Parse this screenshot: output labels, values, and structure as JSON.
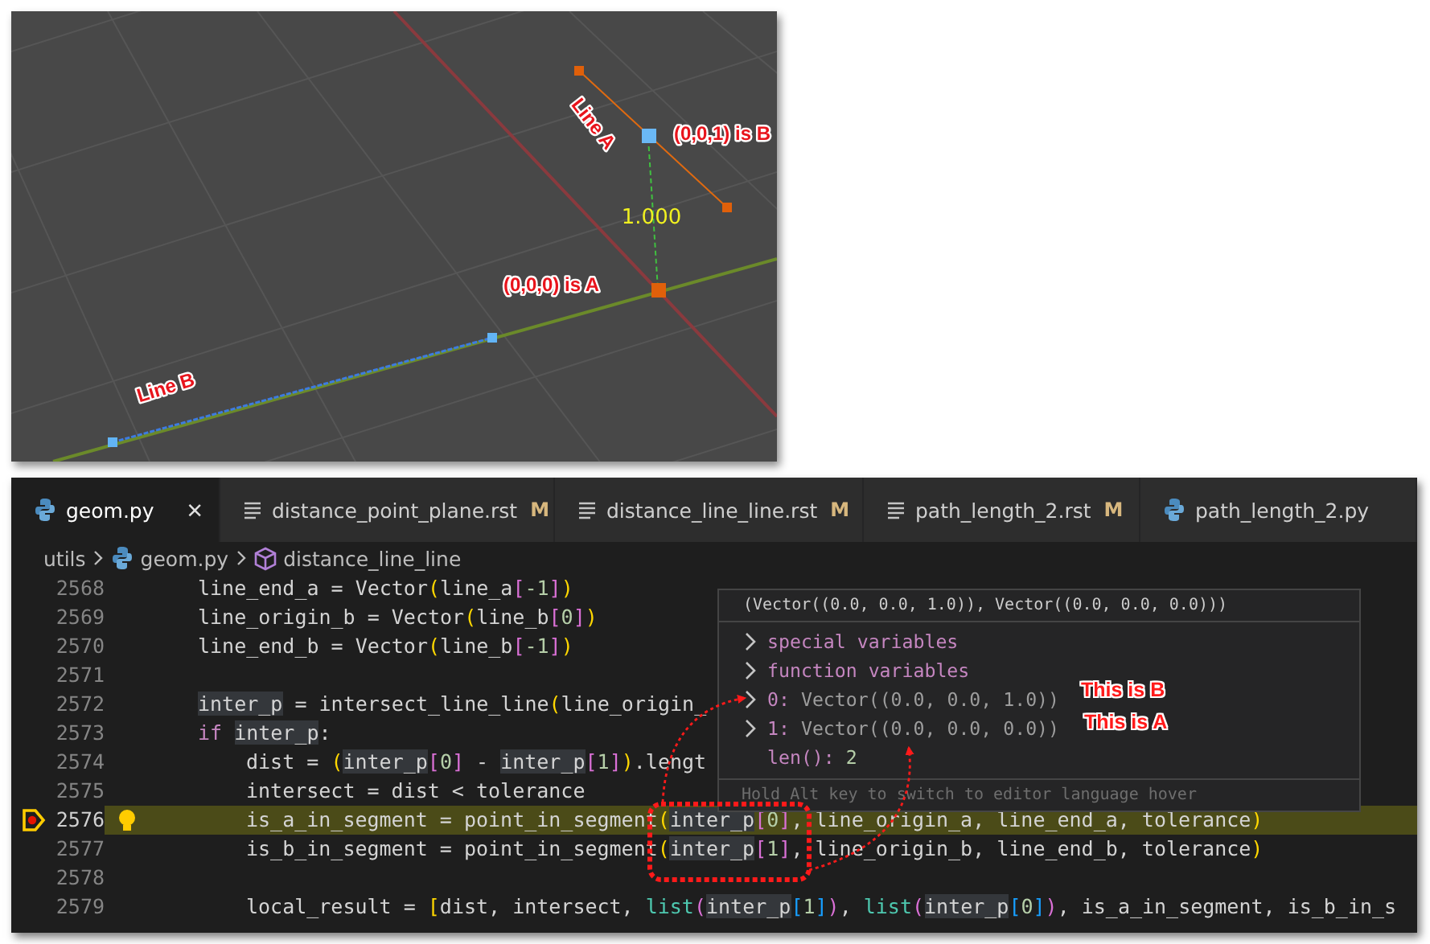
{
  "viewport": {
    "labels": [
      "Line A",
      "(0,0,1) is B",
      "(0,0,0) is A",
      "Line B"
    ],
    "dimension": "1.000"
  },
  "editor": {
    "tabs": [
      {
        "label": "geom.py",
        "kind": "python",
        "close": "×",
        "selected": true
      },
      {
        "label": "distance_point_plane.rst",
        "kind": "text",
        "badge": "M",
        "selected": false
      },
      {
        "label": "distance_line_line.rst",
        "kind": "text",
        "badge": "M",
        "selected": false
      },
      {
        "label": "path_length_2.rst",
        "kind": "text",
        "badge": "M",
        "selected": false
      },
      {
        "label": "path_length_2.py",
        "kind": "python",
        "selected": false
      }
    ],
    "breadcrumb": [
      {
        "label": "utils"
      },
      {
        "label": "geom.py",
        "kind": "python"
      },
      {
        "label": "distance_line_line",
        "kind": "symbol"
      }
    ],
    "lines": [
      {
        "number": "2568",
        "current": false,
        "segments": [
          {
            "text": "line_end_a = Vector",
            "kind": "plain"
          },
          {
            "text": "(",
            "kind": "bracket1"
          },
          {
            "text": "line_a",
            "kind": "plain"
          },
          {
            "text": "[",
            "kind": "bracket2"
          },
          {
            "text": "-1",
            "kind": "number"
          },
          {
            "text": "]",
            "kind": "bracket2"
          },
          {
            "text": ")",
            "kind": "bracket1"
          }
        ]
      },
      {
        "number": "2569",
        "current": false,
        "segments": [
          {
            "text": "line_origin_b = Vector",
            "kind": "plain"
          },
          {
            "text": "(",
            "kind": "bracket1"
          },
          {
            "text": "line_b",
            "kind": "plain"
          },
          {
            "text": "[",
            "kind": "bracket2"
          },
          {
            "text": "0",
            "kind": "number"
          },
          {
            "text": "]",
            "kind": "bracket2"
          },
          {
            "text": ")",
            "kind": "bracket1"
          }
        ]
      },
      {
        "number": "2570",
        "current": false,
        "segments": [
          {
            "text": "line_end_b = Vector",
            "kind": "plain"
          },
          {
            "text": "(",
            "kind": "bracket1"
          },
          {
            "text": "line_b",
            "kind": "plain"
          },
          {
            "text": "[",
            "kind": "bracket2"
          },
          {
            "text": "-1",
            "kind": "number"
          },
          {
            "text": "]",
            "kind": "bracket2"
          },
          {
            "text": ")",
            "kind": "bracket1"
          }
        ]
      },
      {
        "number": "2571",
        "current": false
      },
      {
        "number": "2572",
        "current": false,
        "segments": [
          {
            "text": "inter_p",
            "kind": "ref"
          },
          {
            "text": " = intersect_line_line",
            "kind": "plain"
          },
          {
            "text": "(",
            "kind": "bracket1"
          },
          {
            "text": "line_origin_",
            "kind": "plain"
          }
        ]
      },
      {
        "number": "2573",
        "current": false,
        "segments": [
          {
            "text": "if",
            "kind": "keyword"
          },
          {
            "text": "inter_p",
            "kind": "ref"
          },
          {
            "text": ":",
            "kind": "plain"
          }
        ],
        "children": [
          {
            "number": "2574",
            "current": false,
            "segments": [
              {
                "text": "dist = ",
                "kind": "plain"
              },
              {
                "text": "(",
                "kind": "bracket1"
              },
              {
                "text": "inter_p",
                "kind": "ref"
              },
              {
                "text": "[",
                "kind": "bracket2"
              },
              {
                "text": "0",
                "kind": "number"
              },
              {
                "text": "]",
                "kind": "bracket2"
              },
              {
                "text": " - ",
                "kind": "plain"
              },
              {
                "text": "inter_p",
                "kind": "ref"
              },
              {
                "text": "[",
                "kind": "bracket2"
              },
              {
                "text": "1",
                "kind": "number"
              },
              {
                "text": "]",
                "kind": "bracket2"
              },
              {
                "text": ")",
                "kind": "bracket1"
              },
              {
                "text": ".lengt",
                "kind": "plain"
              }
            ]
          },
          {
            "number": "2575",
            "current": false,
            "segments": [
              {
                "text": "intersect = dist < tolerance",
                "kind": "plain"
              }
            ]
          },
          {
            "number": "2576",
            "current": true,
            "segments": [
              {
                "text": "is_a_in_segment = point_in_segment",
                "kind": "plain"
              },
              {
                "text": "(",
                "kind": "bracket1"
              },
              {
                "text": "inter_p",
                "kind": "ref"
              },
              {
                "text": "[",
                "kind": "bracket2"
              },
              {
                "text": "0",
                "kind": "number"
              },
              {
                "text": "]",
                "kind": "bracket2"
              },
              {
                "text": ", line_origin_a, line_end_a, tolerance",
                "kind": "plain"
              },
              {
                "text": ")",
                "kind": "bracket1"
              }
            ]
          },
          {
            "number": "2577",
            "current": false,
            "segments": [
              {
                "text": "is_b_in_segment = point_in_segment",
                "kind": "plain"
              },
              {
                "text": "(",
                "kind": "bracket1"
              },
              {
                "text": "inter_p",
                "kind": "ref"
              },
              {
                "text": "[",
                "kind": "bracket2"
              },
              {
                "text": "1",
                "kind": "number"
              },
              {
                "text": "]",
                "kind": "bracket2"
              },
              {
                "text": ", line_origin_b, line_end_b, tolerance",
                "kind": "plain"
              },
              {
                "text": ")",
                "kind": "bracket1"
              }
            ]
          },
          {
            "number": "2578",
            "current": false
          },
          {
            "number": "2579",
            "current": false,
            "segments": [
              {
                "text": "local_result = ",
                "kind": "plain"
              },
              {
                "text": "[",
                "kind": "bracket1"
              },
              {
                "text": "dist, intersect, ",
                "kind": "plain"
              },
              {
                "text": "list",
                "kind": "builtin"
              },
              {
                "text": "(",
                "kind": "bracket2"
              },
              {
                "text": "inter_p",
                "kind": "ref"
              },
              {
                "text": "[",
                "kind": "bracket3"
              },
              {
                "text": "1",
                "kind": "number"
              },
              {
                "text": "]",
                "kind": "bracket3"
              },
              {
                "text": ")",
                "kind": "bracket2"
              },
              {
                "text": ", ",
                "kind": "plain"
              },
              {
                "text": "list",
                "kind": "builtin"
              },
              {
                "text": "(",
                "kind": "bracket2"
              },
              {
                "text": "inter_p",
                "kind": "ref"
              },
              {
                "text": "[",
                "kind": "bracket3"
              },
              {
                "text": "0",
                "kind": "number"
              },
              {
                "text": "]",
                "kind": "bracket3"
              },
              {
                "text": ")",
                "kind": "bracket2"
              },
              {
                "text": ", is_a_in_segment, is_b_in_s",
                "kind": "plain"
              }
            ]
          }
        ]
      }
    ],
    "hover": {
      "header": "(Vector((0.0, 0.0, 1.0)), Vector((0.0, 0.0, 0.0)))",
      "items": [
        {
          "kind": "group",
          "name": "special variables",
          "expanded": false
        },
        {
          "kind": "group",
          "name": "function variables",
          "expanded": false
        },
        {
          "kind": "entry",
          "name": "0:",
          "value": "Vector((0.0, 0.0, 1.0))",
          "expanded": false
        },
        {
          "kind": "entry",
          "name": "1:",
          "value": "Vector((0.0, 0.0, 0.0))",
          "expanded": false
        },
        {
          "kind": "leaf",
          "name": "len():",
          "value": "2"
        }
      ],
      "footer": "Hold Alt key to switch to editor language hover"
    },
    "annotations": [
      "This is B",
      "This is A"
    ]
  }
}
